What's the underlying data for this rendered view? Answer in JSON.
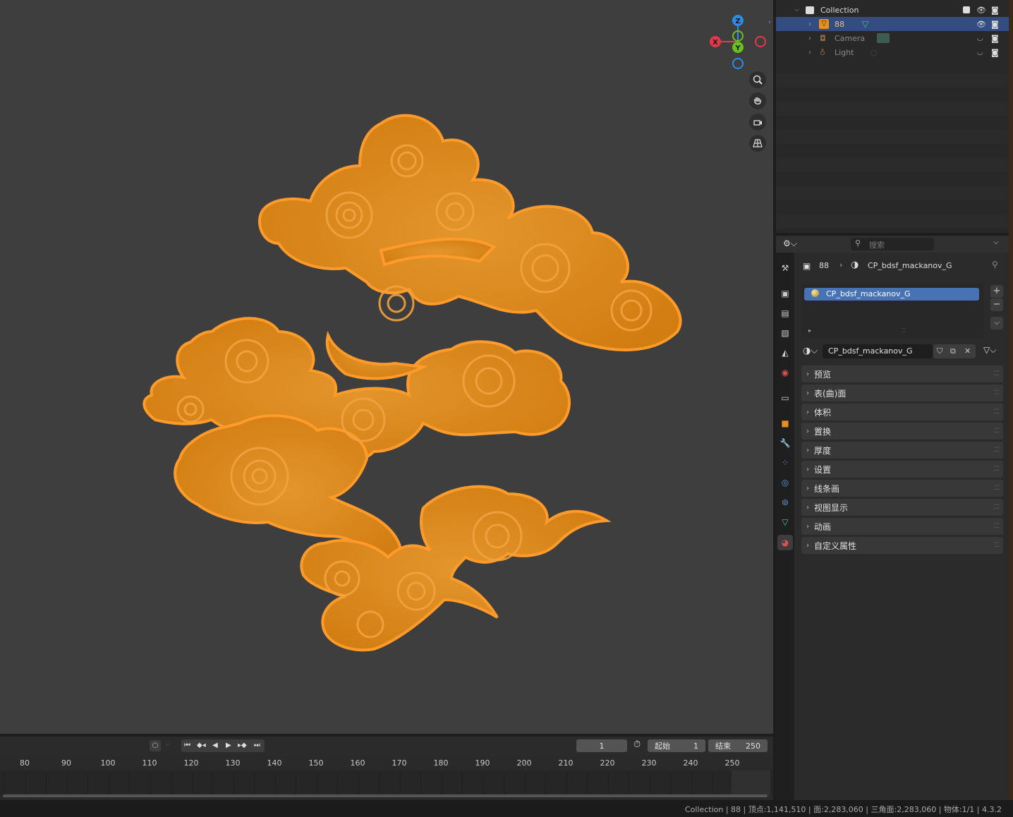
{
  "outliner": {
    "rows": [
      {
        "label": "Collection"
      },
      {
        "label": "88"
      },
      {
        "label": "Camera"
      },
      {
        "label": "Light"
      }
    ]
  },
  "properties": {
    "search_placeholder": "搜索",
    "breadcrumb_object": "88",
    "breadcrumb_material": "CP_bdsf_mackanov_G",
    "slot_name": "CP_bdsf_mackanov_G",
    "material_name": "CP_bdsf_mackanov_G",
    "panels": [
      "预览",
      "表(曲)面",
      "体积",
      "置换",
      "厚度",
      "设置",
      "线条画",
      "视图显示",
      "动画",
      "自定义属性"
    ]
  },
  "gizmo": {
    "z": "Z",
    "x": "X",
    "y": "Y"
  },
  "timeline": {
    "current_frame": "1",
    "start_label": "起始",
    "start_value": "1",
    "end_label": "结束",
    "end_value": "250",
    "frame_labels": [
      "80",
      "90",
      "100",
      "110",
      "120",
      "130",
      "140",
      "150",
      "160",
      "170",
      "180",
      "190",
      "200",
      "210",
      "220",
      "230",
      "240",
      "250"
    ]
  },
  "status": {
    "text": "Collection | 88 | 顶点:1,141,510 | 面:2,283,060 | 三角面:2,283,060 | 物体:1/1 | 4.3.2"
  },
  "colors": {
    "selection": "#334d80",
    "cloud": "#e8901e",
    "cloud_outline": "#ffa93a",
    "viewport_bg": "#3e3e3e"
  }
}
